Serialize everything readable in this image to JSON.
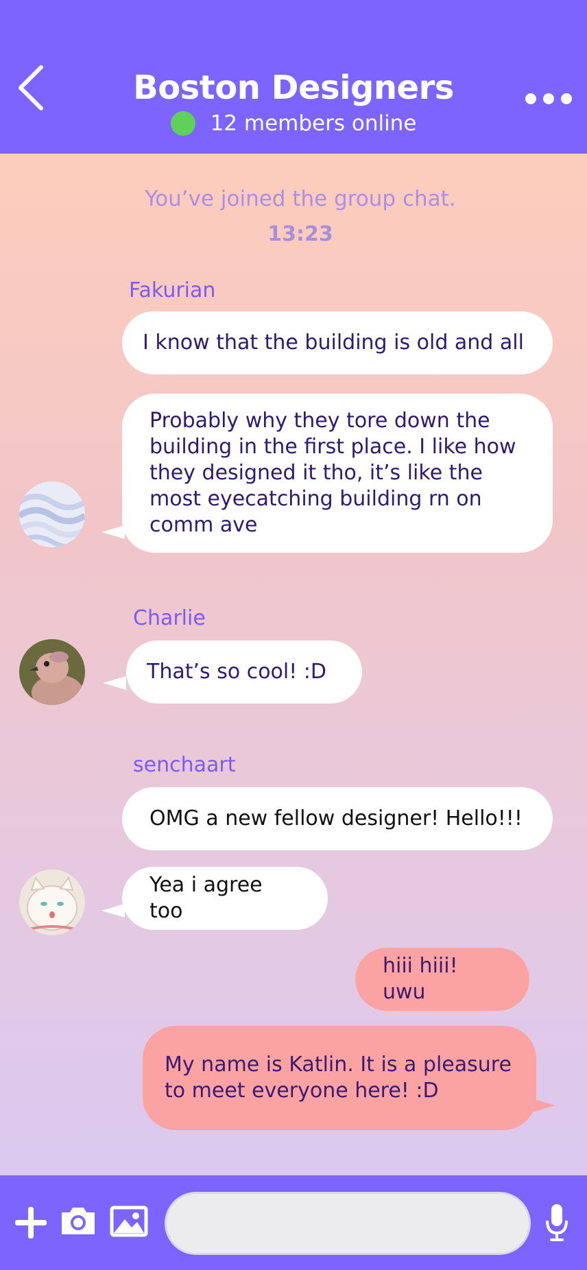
{
  "header": {
    "title": "Boston Designers",
    "status": "12 members online",
    "accent": "#7d63ff",
    "online_color": "#5fd05a"
  },
  "chat": {
    "system_message": "You’ve joined the group chat.",
    "system_time": "13:23",
    "groups": [
      {
        "sender": "Fakurian",
        "avatar": "abstract-wave-avatar",
        "messages": [
          "I know that the building is old and all",
          "Probably why they tore down the building in the first place. I like how they designed it tho, it’s like the most eyecatching building rn on comm ave"
        ]
      },
      {
        "sender": "Charlie",
        "avatar": "dove-avatar",
        "messages": [
          "That’s so cool! :D"
        ]
      },
      {
        "sender": "senchaart",
        "avatar": "cat-illustration-avatar",
        "messages": [
          "OMG a new fellow designer! Hello!!!",
          "Yea i agree too"
        ]
      }
    ],
    "outgoing": [
      "hiii hiii! uwu",
      "My name is Katlin. It is a pleasure to meet everyone here! :D"
    ]
  },
  "composer": {
    "placeholder": "",
    "icons": [
      "plus-icon",
      "camera-icon",
      "image-icon",
      "microphone-icon"
    ]
  },
  "colors": {
    "incoming_bubble": "#ffffff",
    "outgoing_bubble": "#fba3a2",
    "sender_name": "#7a5cf0"
  }
}
